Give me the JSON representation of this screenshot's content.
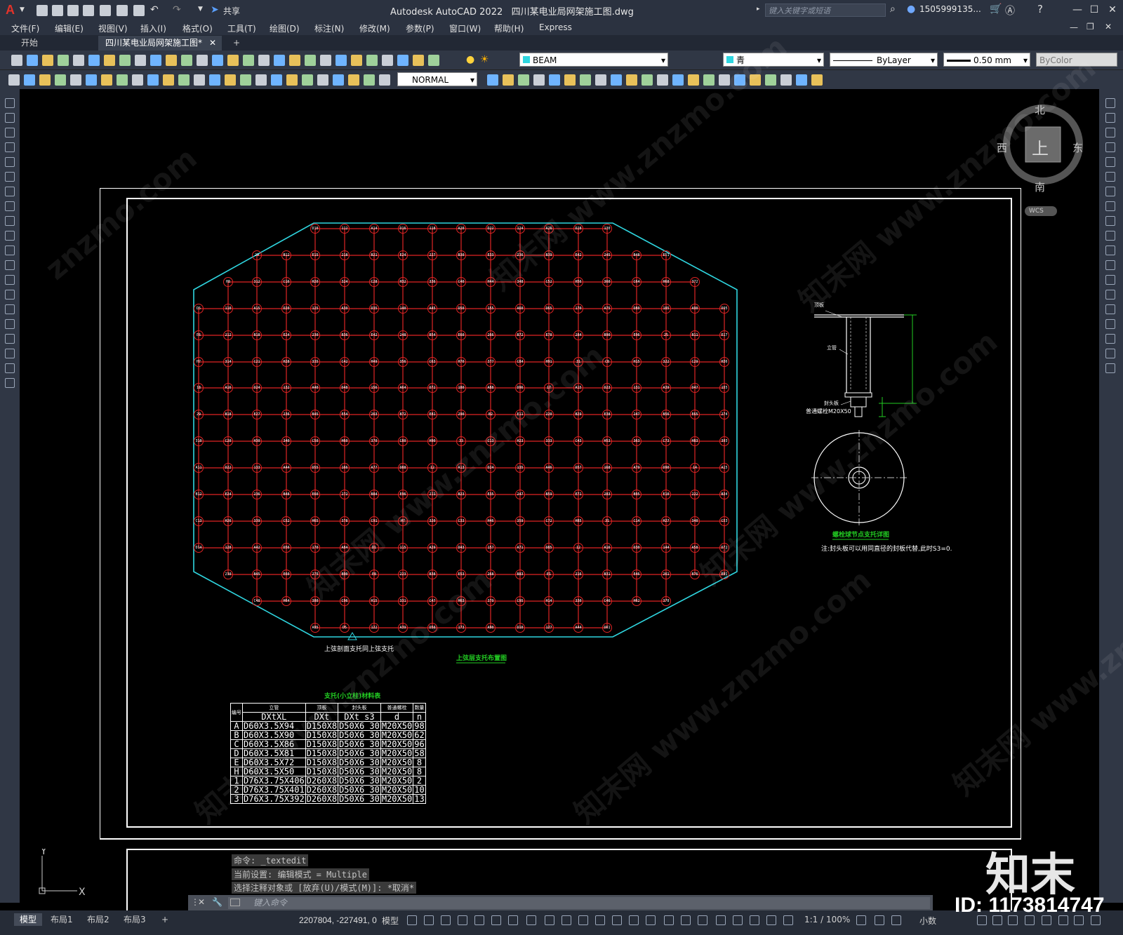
{
  "app": {
    "title": "Autodesk AutoCAD 2022",
    "file": "四川某电业局网架施工图.dwg",
    "share": "共享",
    "search_placeholder": "键入关键字或短语",
    "user": "1505999135..."
  },
  "menu": [
    "文件(F)",
    "编辑(E)",
    "视图(V)",
    "插入(I)",
    "格式(O)",
    "工具(T)",
    "绘图(D)",
    "标注(N)",
    "修改(M)",
    "参数(P)",
    "窗口(W)",
    "帮助(H)",
    "Express"
  ],
  "tabs": {
    "start": "开始",
    "active": "四川某电业局网架施工图*",
    "add": "+"
  },
  "toolbar": {
    "layer": "BEAM",
    "color": "青",
    "linetype": "ByLayer",
    "lineweight": "0.50 mm",
    "plotstyle": "ByColor",
    "dimstyle": "NORMAL"
  },
  "viewcube": {
    "north": "北",
    "south": "南",
    "east": "东",
    "west": "西",
    "face": "上",
    "wcs": "WCS"
  },
  "drawing": {
    "plan_note": "上弦剖面支托同上弦支托",
    "plan_title": "上弦层支托布置图",
    "detail_labels": {
      "plate": "顶板",
      "tube": "立管",
      "cap": "封头板",
      "bolt": "普通螺栓M20X50"
    },
    "detail_title": "螺栓球节点支托详图",
    "detail_note": "注:封头板可以用同直径的封板代替,此时S3=0."
  },
  "row_labels_top": [
    "D272",
    "A69",
    "A254",
    "D222",
    "D194",
    "A163",
    "D137",
    "D113",
    "A90",
    "A69",
    "D50"
  ],
  "material_table": {
    "title": "支托(小立柱)材料表",
    "headers_cn": [
      "编号",
      "立管",
      "顶板",
      "封头板",
      "普通螺栓",
      "数量"
    ],
    "headers_sym": [
      "",
      "DXtXL",
      "DXt",
      "DXt s3",
      "d",
      "n"
    ],
    "rows": [
      [
        "A",
        "D60X3.5X94",
        "D150X8",
        "D50X6 30",
        "M20X50",
        "98"
      ],
      [
        "B",
        "D60X3.5X90",
        "D150X8",
        "D50X6 30",
        "M20X50",
        "62"
      ],
      [
        "C",
        "D60X3.5X86",
        "D150X8",
        "D50X6 30",
        "M20X50",
        "96"
      ],
      [
        "D",
        "D60X3.5X81",
        "D150X8",
        "D50X6 30",
        "M20X50",
        "58"
      ],
      [
        "E",
        "D60X3.5X72",
        "D150X8",
        "D50X6 30",
        "M20X50",
        "8"
      ],
      [
        "H",
        "D60X3.5X50",
        "D150X8",
        "D50X6 30",
        "M20X50",
        "8"
      ],
      [
        "1",
        "D76X3.75X406",
        "D260X8",
        "D50X6 30",
        "M20X50",
        "2"
      ],
      [
        "2",
        "D76X3.75X401",
        "D260X8",
        "D50X6 30",
        "M20X50",
        "10"
      ],
      [
        "3",
        "D76X3.75X392",
        "D260X8",
        "D50X6 30",
        "M20X50",
        "13"
      ]
    ]
  },
  "command": {
    "history": [
      "命令: _textedit",
      "当前设置: 编辑模式 = Multiple",
      "选择注释对象或 [放弃(U)/模式(M)]: *取消*"
    ],
    "input_placeholder": "键入命令"
  },
  "status": {
    "layouts": [
      "模型",
      "布局1",
      "布局2",
      "布局3",
      "+"
    ],
    "coords": "2207804, -227491, 0",
    "model": "模型",
    "scale": "1:1 / 100%",
    "units": "小数"
  },
  "watermark": {
    "brand": "知末",
    "id": "ID: 1173814747"
  },
  "colors": {
    "grid_red": "#e02424",
    "boundary_cyan": "#2fd6e0",
    "detail_green": "#22cc22",
    "frame_white": "#ffffff"
  }
}
